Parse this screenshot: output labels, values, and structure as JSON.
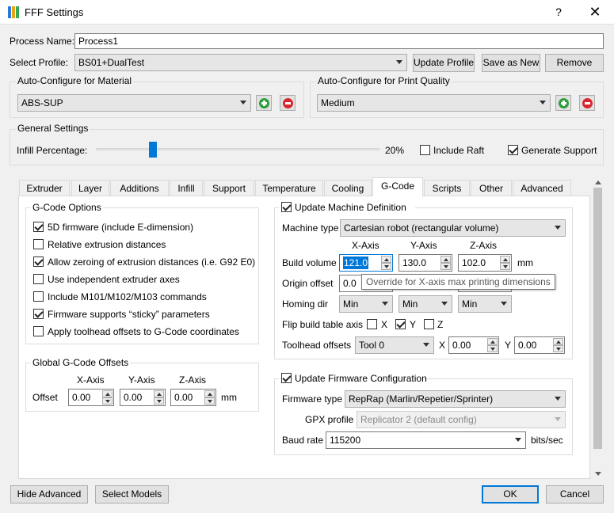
{
  "window": {
    "title": "FFF Settings",
    "help": "?",
    "close": "✕"
  },
  "process_name": {
    "label": "Process Name:",
    "value": "Process1"
  },
  "select_profile": {
    "label": "Select Profile:",
    "value": "BS01+DualTest",
    "update": "Update Profile",
    "save_as_new": "Save as New",
    "remove": "Remove"
  },
  "auto_material": {
    "title": "Auto-Configure for Material",
    "value": "ABS-SUP"
  },
  "auto_quality": {
    "title": "Auto-Configure for Print Quality",
    "value": "Medium"
  },
  "general": {
    "title": "General Settings",
    "infill_label": "Infill Percentage:",
    "infill_value": "20%",
    "infill_fraction": 0.2,
    "include_raft": {
      "label": "Include Raft",
      "checked": false
    },
    "generate_support": {
      "label": "Generate Support",
      "checked": true
    }
  },
  "tabs": [
    "Extruder",
    "Layer",
    "Additions",
    "Infill",
    "Support",
    "Temperature",
    "Cooling",
    "G-Code",
    "Scripts",
    "Other",
    "Advanced"
  ],
  "active_tab": "G-Code",
  "gcode_options": {
    "title": "G-Code Options",
    "items": [
      {
        "label": "5D firmware (include E-dimension)",
        "checked": true
      },
      {
        "label": "Relative extrusion distances",
        "checked": false
      },
      {
        "label": "Allow zeroing of extrusion distances (i.e. G92 E0)",
        "checked": true
      },
      {
        "label": "Use independent extruder axes",
        "checked": false
      },
      {
        "label": "Include M101/M102/M103 commands",
        "checked": false
      },
      {
        "label": "Firmware supports “sticky” parameters",
        "checked": true
      },
      {
        "label": "Apply toolhead offsets to G-Code coordinates",
        "checked": false
      }
    ]
  },
  "global_offsets": {
    "title": "Global G-Code Offsets",
    "x_axis": "X-Axis",
    "y_axis": "Y-Axis",
    "z_axis": "Z-Axis",
    "offset_label": "Offset",
    "x": "0.00",
    "y": "0.00",
    "z": "0.00",
    "unit": "mm"
  },
  "machine": {
    "update_label": "Update Machine Definition",
    "update_checked": true,
    "type_label": "Machine type",
    "type_value": "Cartesian robot (rectangular volume)",
    "x_axis": "X-Axis",
    "y_axis": "Y-Axis",
    "z_axis": "Z-Axis",
    "build_volume_label": "Build volume",
    "bv_x": "121.0",
    "bv_y": "130.0",
    "bv_z": "102.0",
    "bv_unit": "mm",
    "origin_label": "Origin offset",
    "origin_x": "0.0",
    "tooltip": "Override for X-axis max printing dimensions",
    "homing_label": "Homing dir",
    "homing_x": "Min",
    "homing_y": "Min",
    "homing_z": "Min",
    "flip_label": "Flip build table axis",
    "flip_x": "X",
    "flip_y": "Y",
    "flip_z": "Z",
    "flip_x_checked": false,
    "flip_y_checked": true,
    "flip_z_checked": false,
    "toolhead_label": "Toolhead offsets",
    "toolhead_value": "Tool 0",
    "th_x_label": "X",
    "th_x": "0.00",
    "th_y_label": "Y",
    "th_y": "0.00"
  },
  "firmware": {
    "update_label": "Update Firmware Configuration",
    "update_checked": true,
    "type_label": "Firmware type",
    "type_value": "RepRap (Marlin/Repetier/Sprinter)",
    "gpx_label": "GPX profile",
    "gpx_value": "Replicator 2 (default config)",
    "baud_label": "Baud rate",
    "baud_value": "115200",
    "baud_unit": "bits/sec"
  },
  "footer": {
    "hide_advanced": "Hide Advanced",
    "select_models": "Select Models",
    "ok": "OK",
    "cancel": "Cancel"
  },
  "colors": {
    "accent": "#0078d7",
    "add_green": "#2e9e3a",
    "remove_red": "#d8262e",
    "slider_handle": "#0078d7"
  }
}
